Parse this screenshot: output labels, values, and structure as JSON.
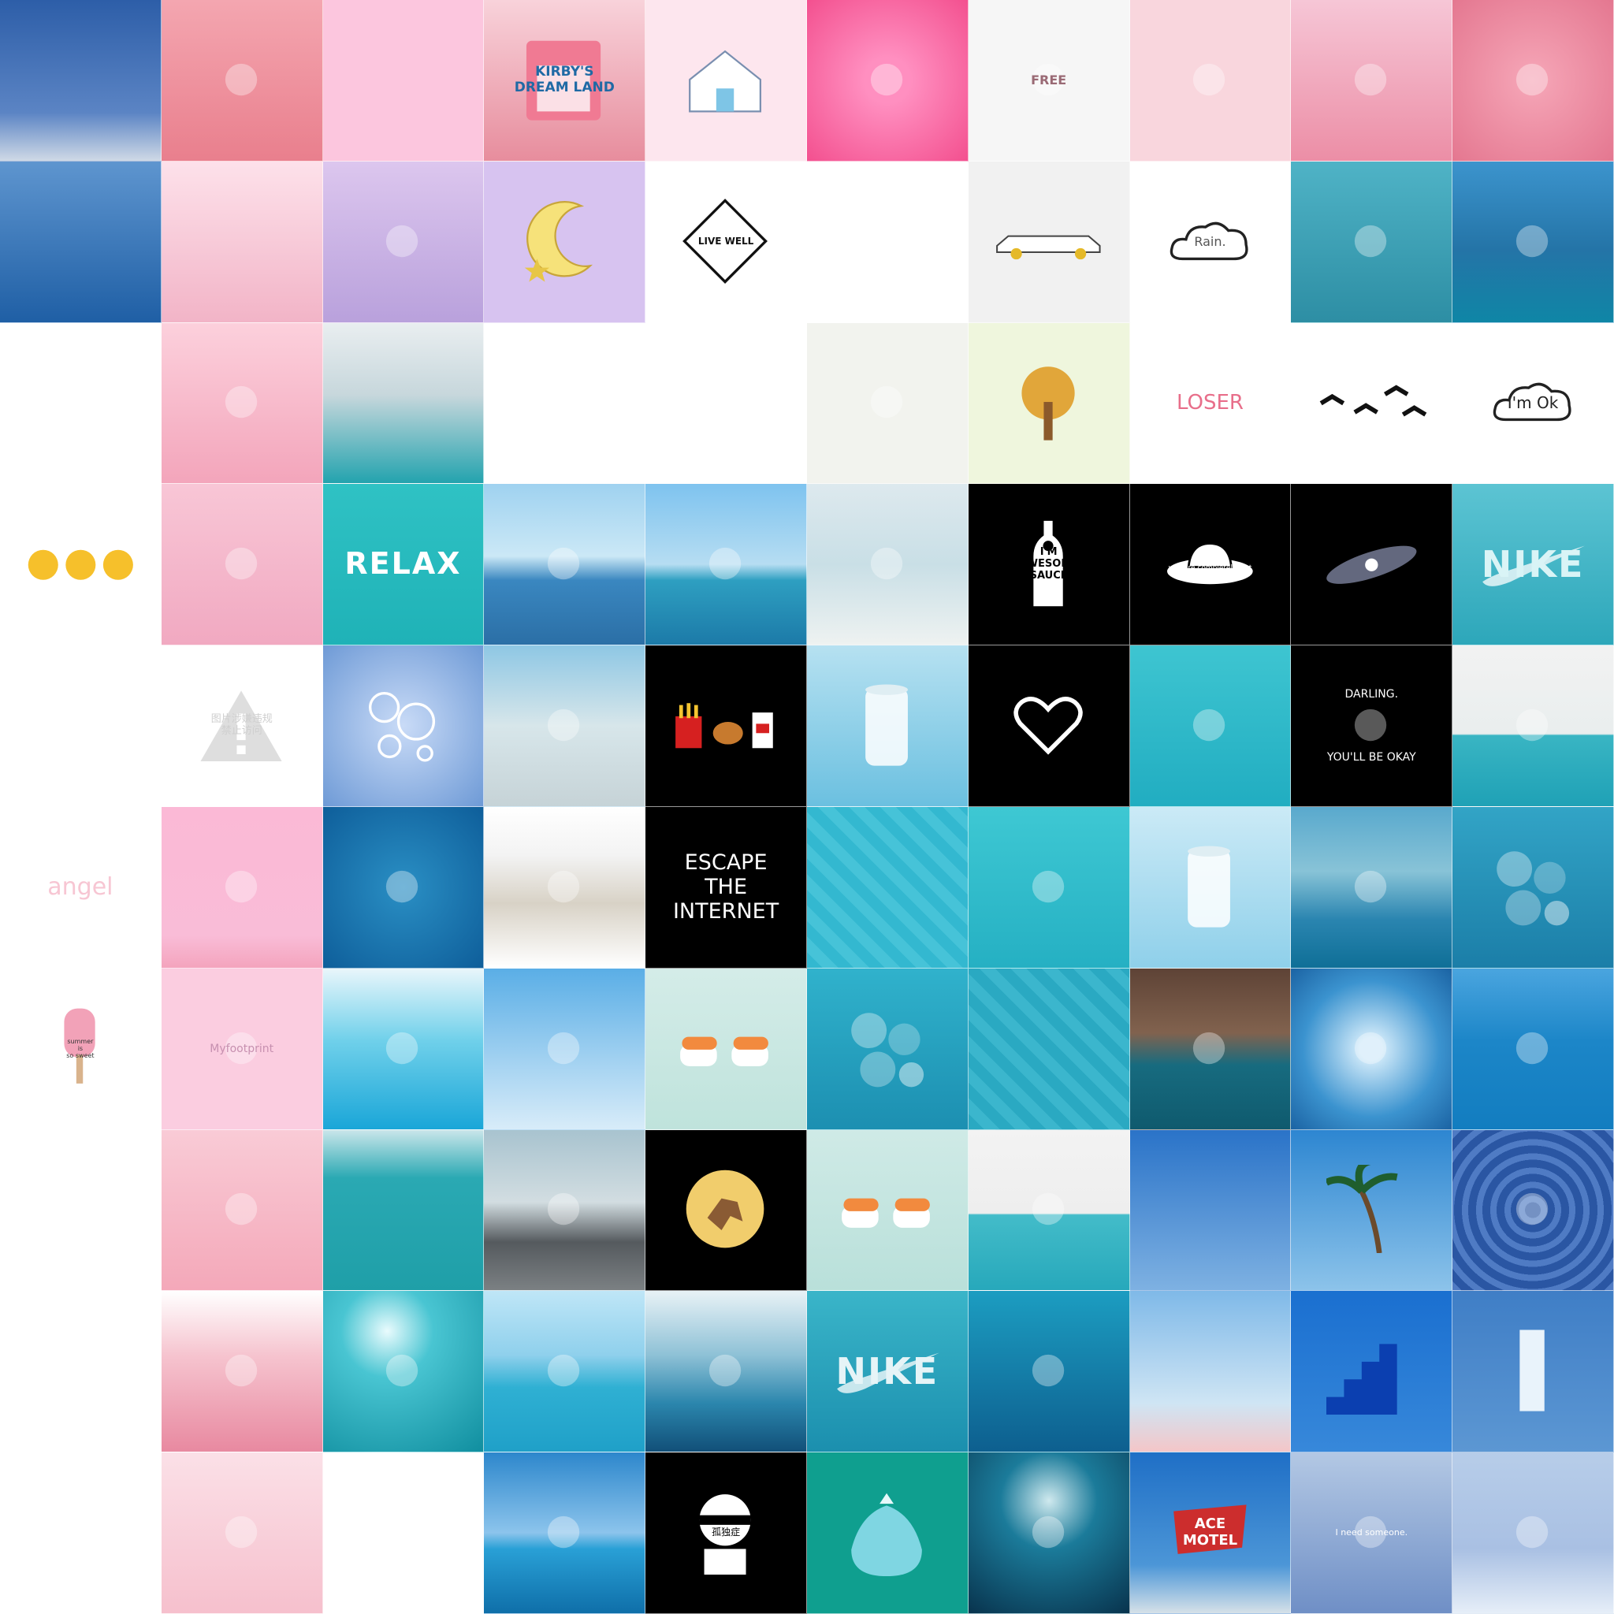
{
  "collage": {
    "columns": 10,
    "rows": 10,
    "tiles": [
      {
        "bg": "linear-gradient(#2d5ea8 0%, #5b84c4 70%, #cfd9e6 100%)"
      },
      {
        "bg": "linear-gradient(#f4a6b0, #e97f8d)",
        "icon": "signpost-icon"
      },
      {
        "bg": "#fcc6de"
      },
      {
        "bg": "linear-gradient(#f8d2da, #e78d9d)",
        "text": "KIRBY'S\nDREAM LAND",
        "color": "#1f6aa5",
        "size": 17,
        "weight": "bold",
        "icon": "game-cartridge-icon"
      },
      {
        "bg": "#fde6ee",
        "icon": "house-icon"
      },
      {
        "bg": "radial-gradient(#ff8fc0 20%, #f3508f 100%)",
        "icon": "cartoon-character-icon"
      },
      {
        "bg": "#f6f6f6",
        "icon": "cup-icon",
        "text": "FREE",
        "color": "#9a6a75",
        "size": 16,
        "weight": "bold"
      },
      {
        "bg": "#f9d6dd",
        "icon": "cactus-pots-icon"
      },
      {
        "bg": "linear-gradient(#f6c6d6, #ec8ea6)",
        "icon": "anime-face-icon"
      },
      {
        "bg": "radial-gradient(#f6a7b8, #e47790)",
        "icon": "rose-icon"
      },
      {
        "bg": "linear-gradient(#5e95cf, #1f5fa5)"
      },
      {
        "bg": "linear-gradient(#fde1ea, #f2b4c7)"
      },
      {
        "bg": "linear-gradient(#dcc6ee, #b9a1dc)",
        "icon": "unicorn-icon"
      },
      {
        "bg": "#d7c3f0",
        "icon": "moon-star-icon"
      },
      {
        "bg": "#ffffff",
        "text": "LIVE WELL",
        "color": "#111111",
        "size": 12,
        "weight": "bold",
        "icon": "diamond-outline-icon"
      },
      {
        "bg": "#ffffff",
        "icon": "swing-person-icon"
      },
      {
        "bg": "#f1f1f1",
        "icon": "limousine-icon"
      },
      {
        "bg": "#ffffff",
        "text": "Rain.",
        "color": "#555555",
        "size": 16,
        "weight": "normal",
        "icon": "cloud-icon"
      },
      {
        "bg": "linear-gradient(#4fb3c6, #2d8ea4)",
        "icon": "water-ripple-icon"
      },
      {
        "bg": "linear-gradient(#3c94cd 0%, #2474a7 55%, #0f86a6 100%)",
        "icon": "wave-icon"
      },
      {
        "bg": "#ffffff",
        "icon": "three-figures-icon"
      },
      {
        "bg": "linear-gradient(#fcd0dc, #f3a5bb)",
        "icon": "keychain-icon"
      },
      {
        "bg": "linear-gradient(#e9eef0 0%, #c7d7dc 45%, #23a3ae 100%)"
      },
      {
        "bg": "#ffffff",
        "icon": "moomin-icon"
      },
      {
        "bg": "#ffffff",
        "icon": "umbrella-icon"
      },
      {
        "bg": "#f2f3ee",
        "icon": "peeking-face-icon"
      },
      {
        "bg": "#eff6dd",
        "icon": "tree-icon"
      },
      {
        "bg": "#ffffff",
        "text": "LOSER",
        "color": "#e86e8a",
        "size": 26,
        "weight": "normal",
        "icon": "hand-gesture-icon"
      },
      {
        "bg": "#ffffff",
        "icon": "birds-icon"
      },
      {
        "bg": "#ffffff",
        "text": "I'm  Ok",
        "color": "#222222",
        "size": 20,
        "weight": "normal",
        "icon": "cloud-icon"
      },
      {
        "bg": "#ffffff",
        "icon": "emoji-faces-icon"
      },
      {
        "bg": "linear-gradient(#f8c6d6, #f1a9c1)",
        "icon": "pink-objects-icon"
      },
      {
        "bg": "linear-gradient(#2fc2c4, #1fb2b7)",
        "text": "RELAX",
        "color": "#ffffff",
        "size": 38,
        "weight": "bold"
      },
      {
        "bg": "linear-gradient(#9fd2f0 0%, #cbe8f6 45%, #3a87c0 60%, #2b6fa6 100%)",
        "icon": "boats-icon"
      },
      {
        "bg": "linear-gradient(#7ec3ef 0%, #b6ddf2 50%, #2e9fc1 60%, #1c7aa8 100%)",
        "icon": "floating-house-icon"
      },
      {
        "bg": "linear-gradient(#dde9ee 0%, #c9dfe6 50%, #eef2f1 100%)",
        "icon": "beach-umbrella-icon"
      },
      {
        "bg": "#000000",
        "text": "I'M\nAWESOME\nSAUCE",
        "color": "#000000",
        "size": 13,
        "weight": "bold",
        "icon": "bottle-icon"
      },
      {
        "bg": "#000000",
        "text": "Admit it\nyou are completely lost",
        "color": "#ffffff",
        "size": 9,
        "weight": "normal",
        "icon": "ufo-icon"
      },
      {
        "bg": "#000000",
        "icon": "galaxy-icon"
      },
      {
        "bg": "linear-gradient(#5cc4d3, #2da7ba)",
        "text": "NIKE",
        "color": "#d9f4f6",
        "size": 46,
        "weight": "bold",
        "icon": "swoosh-icon"
      },
      {
        "bg": "#ffffff",
        "icon": "omelette-icon"
      },
      {
        "bg": "#ffffff",
        "text": "图片涉嫌违规\n禁止访问",
        "color": "#cfcfcf",
        "size": 13,
        "weight": "normal",
        "icon": "warning-icon"
      },
      {
        "bg": "radial-gradient(#c9dbf7, #6e9ad6)",
        "icon": "bubbles-icon"
      },
      {
        "bg": "linear-gradient(#8ec7e4 0%, #d7e6ea 50%, #c6d3d7 100%)",
        "icon": "lighthouse-icon"
      },
      {
        "bg": "#000000",
        "icon": "fast-food-icon"
      },
      {
        "bg": "linear-gradient(#b6e1f1, #6bc0e0)",
        "icon": "soda-can-icon"
      },
      {
        "bg": "#000000",
        "icon": "heart-icon"
      },
      {
        "bg": "linear-gradient(#3ec5d1, #21adc1)",
        "icon": "swimmers-icon"
      },
      {
        "bg": "#000000",
        "text": "DARLING.\n\n\n\n\nYOU'LL BE OKAY",
        "color": "#ffffff",
        "size": 14,
        "weight": "normal",
        "icon": "holding-hands-icon"
      },
      {
        "bg": "linear-gradient(#f2f2f2 0%, #e9eeee 55%, #39b5c3 56%, #1fa1b6 100%)",
        "icon": "diver-icon"
      },
      {
        "bg": "#ffffff",
        "text": "angel",
        "color": "#f7c6d3",
        "size": 30,
        "weight": "normal"
      },
      {
        "bg": "linear-gradient(#fbb9d6 0%, #f9bcd7 80%, #f4a4bd 100%)",
        "icon": "roses-row-icon"
      },
      {
        "bg": "radial-gradient(#2a8fc4, #0e5e9a)",
        "icon": "water-ripple-icon"
      },
      {
        "bg": "linear-gradient(#ffffff 0%, #f3f3f3 30%, #d8d2c6 60%, #ffffff 100%)",
        "icon": "city-icon"
      },
      {
        "bg": "#000000",
        "text": "ESCAPE\nTHE\nINTERNET",
        "color": "#ffffff",
        "size": 27,
        "weight": "normal"
      },
      {
        "bg": "repeating-linear-gradient(45deg, #33b8d0 0px, #33b8d0 14px, #46c3d8 14px, #46c3d8 28px)"
      },
      {
        "bg": "linear-gradient(#3ec8d3, #25b0c3)",
        "icon": "swimmers-icon"
      },
      {
        "bg": "linear-gradient(#cbeaf6, #8fd0ea)",
        "icon": "soda-can-icon"
      },
      {
        "bg": "linear-gradient(#59a9cd 0%, #88c3d7 40%, #2a85b0 70%, #0f6f97 100%)",
        "icon": "clouds-icon"
      },
      {
        "bg": "linear-gradient(#32a4c6, #1b7ea8)",
        "icon": "gummy-icon"
      },
      {
        "bg": "#ffffff",
        "text": "summer\nis\nso sweet",
        "color": "#333333",
        "size": 8,
        "weight": "normal",
        "icon": "popsicle-icon"
      },
      {
        "bg": "#fbcde0",
        "text": "Myfootprint",
        "color": "#c790b0",
        "size": 14,
        "weight": "normal",
        "icon": "cat-face-icon"
      },
      {
        "bg": "linear-gradient(#e9f6fb 0%, #6fd0ea 45%, #1aa6d8 100%)",
        "icon": "splash-icon"
      },
      {
        "bg": "linear-gradient(#5aaee6, #d8ecf9)",
        "icon": "palm-trunk-icon"
      },
      {
        "bg": "linear-gradient(#d4ece8, #bfe3dc)",
        "icon": "sushi-icon"
      },
      {
        "bg": "linear-gradient(#30b2cc, #1c8fb1)",
        "icon": "gummy-icon"
      },
      {
        "bg": "repeating-linear-gradient(45deg, #2aa9c2 0px, #2aa9c2 14px, #3bb6cd 14px, #3bb6cd 28px)"
      },
      {
        "bg": "linear-gradient(#5e4336 0%, #81624e 40%, #176b7f 60%, #0f5a6e 100%)",
        "icon": "cliff-icon"
      },
      {
        "bg": "radial-gradient(#cfe9f9 10%, #3b93cf 60%, #1b63a3 100%)",
        "icon": "sun-ray-icon"
      },
      {
        "bg": "linear-gradient(#4aa5df 0%, #1c86c8 45%, #127dc0 100%)",
        "icon": "swimmers-icon"
      },
      {
        "bg": "#ffffff",
        "icon": "kawaii-items-icon"
      },
      {
        "bg": "linear-gradient(#f9cbd6, #f4a8b9)",
        "icon": "jar-icon"
      },
      {
        "bg": "linear-gradient(#c9e6ea 0%, #2aa9b3 30%, #1f9fa8 100%)"
      },
      {
        "bg": "linear-gradient(#a8c3cf 0%, #d2dde1 45%, #555a5e 70%, #7b8083 100%)",
        "icon": "rainbow-icon"
      },
      {
        "bg": "#000000",
        "icon": "tintin-icon"
      },
      {
        "bg": "linear-gradient(#cfeae6, #b9e0da)",
        "icon": "sushi-icon"
      },
      {
        "bg": "linear-gradient(#f3f3f3 0%, #eeeeee 52%, #43bcc9 53%, #27a8bb 100%)",
        "icon": "diver-icon"
      },
      {
        "bg": "linear-gradient(#2a73c8, #7eb1e2)"
      },
      {
        "bg": "linear-gradient(#2d86d1, #8cc3ea)",
        "icon": "palm-tree-icon"
      },
      {
        "bg": "repeating-radial-gradient(circle at 50% 50%, #2a56a3 0px, #2a56a3 10px, #4f7bc4 10px, #4f7bc4 18px)",
        "icon": "swirl-icon"
      },
      {
        "bg": "#ffffff",
        "icon": "girl-figure-icon"
      },
      {
        "bg": "linear-gradient(#ffffff 0%, #f6c4cf 40%, #e889a0 100%)",
        "icon": "candy-tub-icon"
      },
      {
        "bg": "radial-gradient(circle at 40% 25%, #e9fbfd 0%, #49c5d2 30%, #108e9f 100%)",
        "icon": "sparkle-icon"
      },
      {
        "bg": "linear-gradient(#bfe6f7 0%, #8fd0ec 40%, #2fb0d3 60%, #1fa0c8 100%)",
        "icon": "ferry-icon"
      },
      {
        "bg": "linear-gradient(#e8f2f6 0%, #8ec1d6 40%, #2b86ad 70%, #114f78 100%)",
        "icon": "clouds-icon"
      },
      {
        "bg": "linear-gradient(#3ab5c9, #1b8fae)",
        "text": "NIKE",
        "color": "#e6f4f7",
        "size": 46,
        "weight": "bold",
        "icon": "swoosh-icon"
      },
      {
        "bg": "linear-gradient(#1c9dc1, #0d5f8f)",
        "icon": "diver-icon"
      },
      {
        "bg": "linear-gradient(#7fb9e8 0%, #cfe5f4 70%, #f4c6c8 100%)"
      },
      {
        "bg": "linear-gradient(#1a6fd0, #3788da)",
        "icon": "stairs-icon"
      },
      {
        "bg": "linear-gradient(#3f7ec6, #5c97d3)",
        "icon": "doorway-icon"
      },
      {
        "bg": "#ffffff",
        "icon": "girl-figure-icon"
      },
      {
        "bg": "linear-gradient(#fbe0e7, #f6c0cd)",
        "icon": "popcorn-box-icon"
      },
      {
        "bg": "#ffffff",
        "icon": "moomin-icon"
      },
      {
        "bg": "linear-gradient(#2d87cc 0%, #8cc4ec 50%, #29a0d6 60%, #0f6fa9 100%)",
        "icon": "boat-icon"
      },
      {
        "bg": "#000000",
        "text": "孤独症",
        "color": "#000000",
        "size": 12,
        "weight": "normal",
        "icon": "blindfold-face-icon"
      },
      {
        "bg": "#0f9f8f",
        "icon": "fish-bag-icon"
      },
      {
        "bg": "radial-gradient(circle at 50% 30%, #cfe9ee 0%, #1b7b9a 35%, #08334d 100%)",
        "icon": "cave-diver-icon"
      },
      {
        "bg": "linear-gradient(#1f6fc6 0%, #4c96d7 70%, #d6e1e8 100%)",
        "text": "ACE\nMOTEL",
        "color": "#ffffff",
        "size": 18,
        "weight": "bold",
        "icon": "motel-sign-icon"
      },
      {
        "bg": "linear-gradient(#b3c8e4, #6f8fc6)",
        "text": "I need someone.",
        "color": "#ffffff",
        "size": 11,
        "weight": "normal",
        "icon": "anime-boy-icon"
      },
      {
        "bg": "linear-gradient(#b7cde9 0%, #a9c0e3 60%, #e6eef8 100%)",
        "icon": "building-icon"
      }
    ]
  }
}
